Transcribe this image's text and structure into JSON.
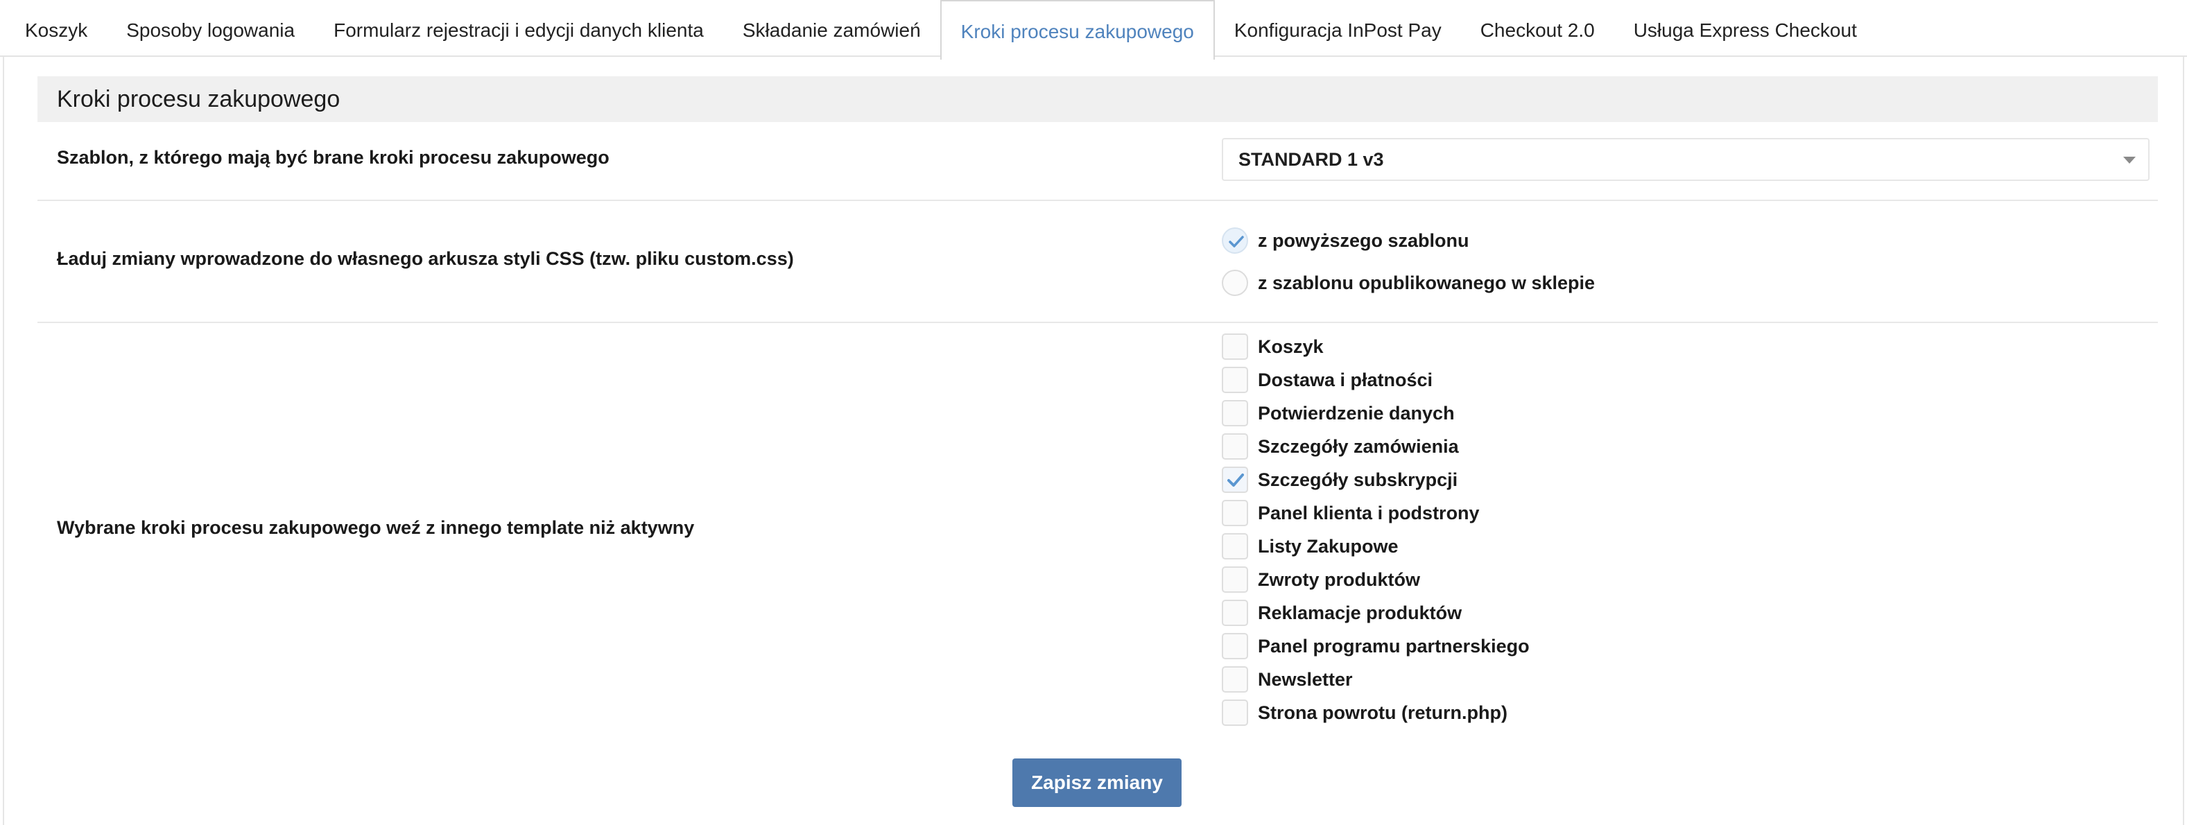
{
  "tabs": [
    {
      "label": "Koszyk"
    },
    {
      "label": "Sposoby logowania"
    },
    {
      "label": "Formularz rejestracji i edycji danych klienta"
    },
    {
      "label": "Składanie zamówień"
    },
    {
      "label": "Kroki procesu zakupowego"
    },
    {
      "label": "Konfiguracja InPost Pay"
    },
    {
      "label": "Checkout 2.0"
    },
    {
      "label": "Usługa Express Checkout"
    }
  ],
  "active_tab": "Kroki procesu zakupowego",
  "section": {
    "title": "Kroki procesu zakupowego"
  },
  "template_row": {
    "label": "Szablon, z którego mają być brane kroki procesu zakupowego",
    "selected": "STANDARD 1 v3"
  },
  "css_row": {
    "label": "Ładuj zmiany wprowadzone do własnego arkusza styli CSS (tzw. pliku custom.css)",
    "options": [
      {
        "label": "z powyższego szablonu",
        "checked": true
      },
      {
        "label": "z szablonu opublikowanego w sklepie",
        "checked": false
      }
    ]
  },
  "steps_row": {
    "label": "Wybrane kroki procesu zakupowego weź z innego template niż aktywny",
    "items": [
      {
        "label": "Koszyk",
        "checked": false
      },
      {
        "label": "Dostawa i płatności",
        "checked": false
      },
      {
        "label": "Potwierdzenie danych",
        "checked": false
      },
      {
        "label": "Szczegóły zamówienia",
        "checked": false
      },
      {
        "label": "Szczegóły subskrypcji",
        "checked": true
      },
      {
        "label": "Panel klienta i podstrony",
        "checked": false
      },
      {
        "label": "Listy Zakupowe",
        "checked": false
      },
      {
        "label": "Zwroty produktów",
        "checked": false
      },
      {
        "label": "Reklamacje produktów",
        "checked": false
      },
      {
        "label": "Panel programu partnerskiego",
        "checked": false
      },
      {
        "label": "Newsletter",
        "checked": false
      },
      {
        "label": "Strona powrotu (return.php)",
        "checked": false
      }
    ]
  },
  "save_button": {
    "label": "Zapisz zmiany"
  },
  "colors": {
    "accent": "#4f83bd",
    "button": "#4e79ad",
    "check": "#5a96d0"
  },
  "icons": {
    "select_arrow": "caret-down-icon",
    "check": "check-icon"
  }
}
